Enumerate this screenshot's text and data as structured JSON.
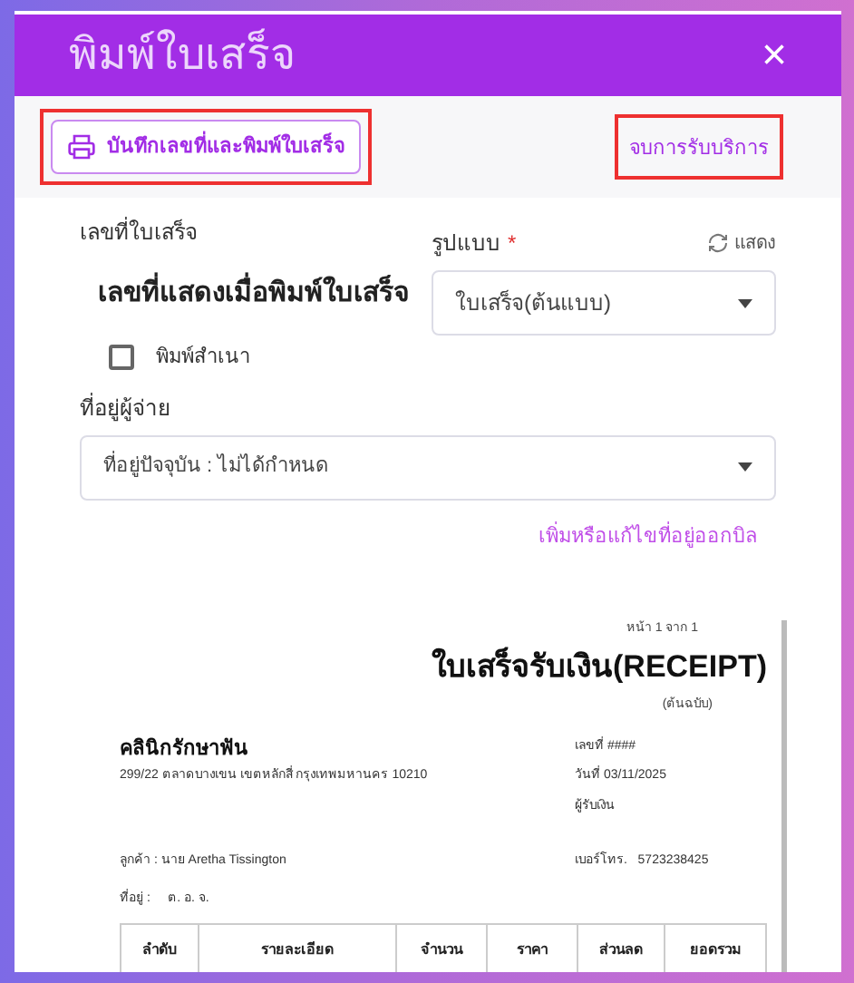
{
  "dialog": {
    "title": "พิมพ์ใบเสร็จ",
    "close": "×"
  },
  "toolbar": {
    "save_print_button": {
      "label": "บันทึกเลขที่และพิมพ์ใบเสร็จ",
      "highlighted": true
    },
    "finish_link": {
      "label": "จบการรับบริการ",
      "highlighted": true
    }
  },
  "form": {
    "receipt_no_label": "เลขที่ใบเสร็จ",
    "receipt_no_value": "เลขที่แสดงเมื่อพิมพ์ใบเสร็จ",
    "format_label": "รูปแบบ",
    "required_mark": "*",
    "refresh_label": "แสดง",
    "format_value": "ใบเสร็จ(ต้นแบบ)",
    "copy_checkbox": {
      "label": "พิมพ์สำเนา",
      "checked": false
    },
    "payer_address_label": "ที่อยู่ผู้จ่าย",
    "payer_address_value": "ที่อยู่ปัจจุบัน : ไม่ได้กำหนด",
    "edit_address_link": "เพิ่มหรือแก้ไขที่อยู่ออกบิล"
  },
  "receipt": {
    "page": "หน้า 1 จาก 1",
    "title": "ใบเสร็จรับเงิน(RECEIPT)",
    "subtitle": "(ต้นฉบับ)",
    "clinic": "คลินิกรักษาฟัน",
    "clinic_address": "299/22 ตลาดบางเขน เขตหลักสี่ กรุงเทพมหานคร 10210",
    "number": "เลขที่ ####",
    "date": "วันที่  03/11/2025",
    "receiver": "ผู้รับเงิน",
    "customer": "ลูกค้า : นาย Aretha Tissington",
    "phone": "เบอร์โทร.   5723238425",
    "address": "ที่อยู่ :     ต. อ. จ.",
    "columns": [
      "ลำดับ",
      "รายละเอียด",
      "จำนวน",
      "ราคา",
      "ส่วนลด",
      "ยอดรวม"
    ]
  }
}
